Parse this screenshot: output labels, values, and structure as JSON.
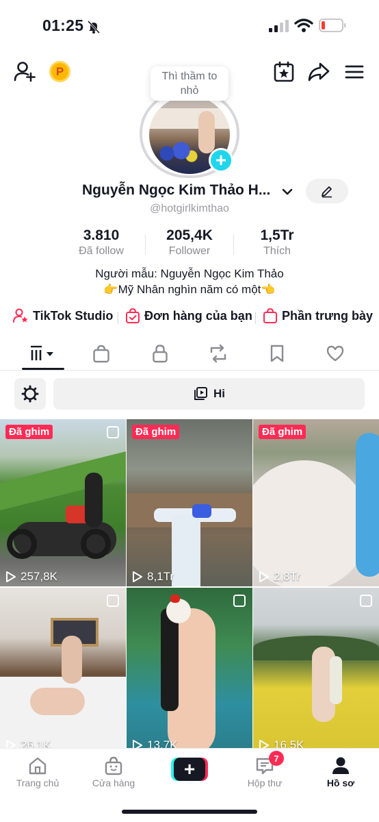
{
  "status_bar": {
    "time": "01:25"
  },
  "tooltip": {
    "line1": "Thì thầm to",
    "line2": "nhỏ"
  },
  "coin_glyph": "P",
  "profile": {
    "name": "Nguyễn Ngọc Kim Thảo H...",
    "username": "@hotgirlkimthao",
    "stats": [
      {
        "value": "3.810",
        "label": "Đã follow"
      },
      {
        "value": "205,4K",
        "label": "Follower"
      },
      {
        "value": "1,5Tr",
        "label": "Thích"
      }
    ],
    "bio_line1": "Người mẫu: Nguyễn Ngọc Kim Thảo",
    "bio_line2": "👉Mỹ Nhân nghìn năm có một👈"
  },
  "links": [
    {
      "label": "TikTok Studio",
      "icon": "user-star-icon"
    },
    {
      "label": "Đơn hàng của bạn",
      "icon": "order-bag-icon"
    },
    {
      "label": "Phần trưng bày",
      "icon": "shopping-bag-icon"
    }
  ],
  "tabs": [
    {
      "name": "videos",
      "icon": "grid-bars-icon",
      "active": true
    },
    {
      "name": "shop",
      "icon": "bag-icon"
    },
    {
      "name": "private",
      "icon": "lock-icon"
    },
    {
      "name": "reposts",
      "icon": "repost-icon"
    },
    {
      "name": "saved",
      "icon": "bookmark-icon"
    },
    {
      "name": "liked",
      "icon": "heart-icon"
    }
  ],
  "filter": {
    "playlist_label": "Hi"
  },
  "videos": [
    {
      "pinned": true,
      "pin_label": "Đã ghim",
      "views": "257,8K",
      "multi": true
    },
    {
      "pinned": true,
      "pin_label": "Đã ghim",
      "views": "8,1Tr",
      "multi": false
    },
    {
      "pinned": true,
      "pin_label": "Đã ghim",
      "views": "2,8Tr",
      "multi": false
    },
    {
      "pinned": false,
      "views": "26,1K",
      "multi": true
    },
    {
      "pinned": false,
      "views": "13,7K",
      "multi": true
    },
    {
      "pinned": false,
      "views": "16,5K",
      "multi": true
    }
  ],
  "bottom_nav": {
    "items": [
      {
        "label": "Trang chủ",
        "icon": "home-icon"
      },
      {
        "label": "Cửa hàng",
        "icon": "shop-bag-icon"
      },
      {
        "label": "",
        "icon": "create-plus-icon"
      },
      {
        "label": "Hộp thư",
        "icon": "inbox-icon"
      },
      {
        "label": "Hồ sơ",
        "icon": "profile-icon",
        "active": true
      }
    ],
    "inbox_badge": "7"
  },
  "colors": {
    "accent": "#fe2c55",
    "cyan": "#25f4ee",
    "text": "#161823",
    "muted": "#8a8b91"
  }
}
